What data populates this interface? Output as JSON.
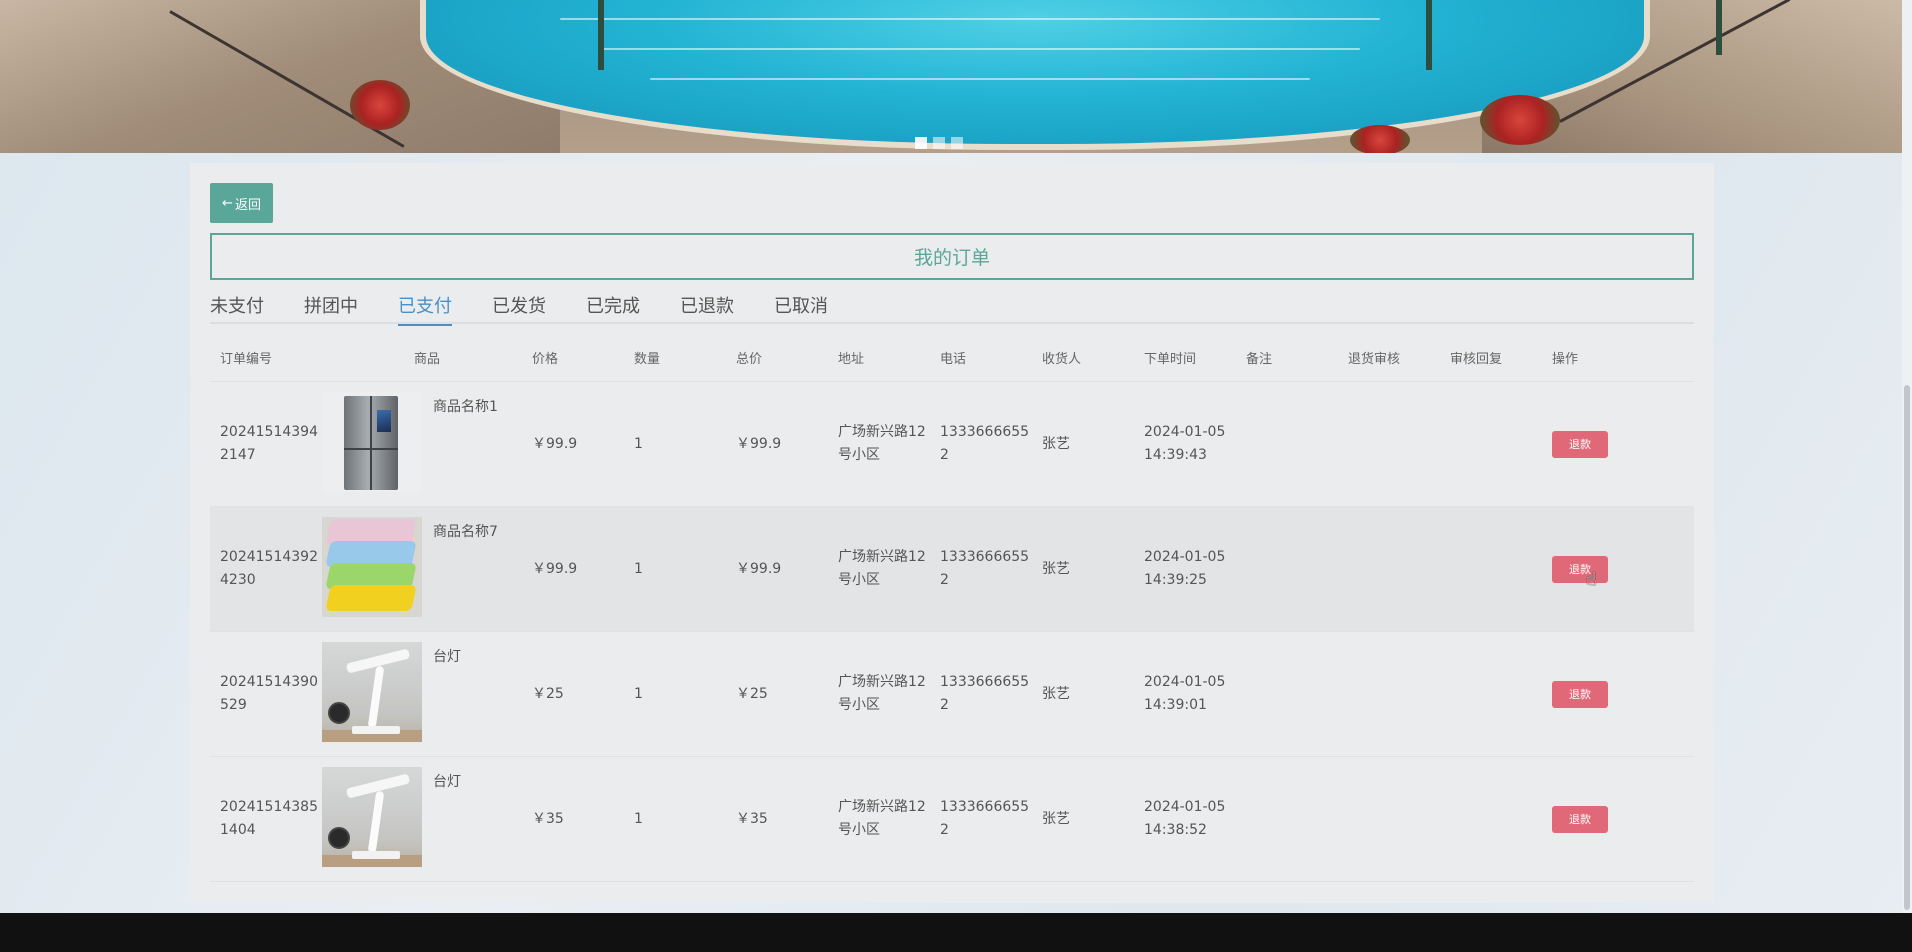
{
  "back_button": {
    "label": "返回",
    "icon": "arrow-left-icon"
  },
  "page_title": "我的订单",
  "tabs": [
    {
      "label": "未支付",
      "active": false
    },
    {
      "label": "拼团中",
      "active": false
    },
    {
      "label": "已支付",
      "active": true
    },
    {
      "label": "已发货",
      "active": false
    },
    {
      "label": "已完成",
      "active": false
    },
    {
      "label": "已退款",
      "active": false
    },
    {
      "label": "已取消",
      "active": false
    }
  ],
  "table": {
    "headers": {
      "order_no": "订单编号",
      "product": "商品",
      "price": "价格",
      "quantity": "数量",
      "total": "总价",
      "address": "地址",
      "phone": "电话",
      "receiver": "收货人",
      "order_time": "下单时间",
      "note": "备注",
      "return_audit": "退货审核",
      "audit_reply": "审核回复",
      "action": "操作"
    },
    "rows": [
      {
        "order_no": "202415143942147",
        "product_name": "商品名称1",
        "product_image": "fridge-image",
        "price": "￥99.9",
        "quantity": "1",
        "total": "￥99.9",
        "address": "广场新兴路12号小区",
        "phone": "13336666552",
        "receiver": "张艺",
        "order_time": "2024-01-05 14:39:43",
        "note": "",
        "return_audit": "",
        "audit_reply": "",
        "action": "退款"
      },
      {
        "order_no": "202415143924230",
        "product_name": "商品名称7",
        "product_image": "towels-image",
        "price": "￥99.9",
        "quantity": "1",
        "total": "￥99.9",
        "address": "广场新兴路12号小区",
        "phone": "13336666552",
        "receiver": "张艺",
        "order_time": "2024-01-05 14:39:25",
        "note": "",
        "return_audit": "",
        "audit_reply": "",
        "action": "退款"
      },
      {
        "order_no": "20241514390529",
        "product_name": "台灯",
        "product_image": "desk-lamp-image",
        "price": "￥25",
        "quantity": "1",
        "total": "￥25",
        "address": "广场新兴路12号小区",
        "phone": "13336666552",
        "receiver": "张艺",
        "order_time": "2024-01-05 14:39:01",
        "note": "",
        "return_audit": "",
        "audit_reply": "",
        "action": "退款"
      },
      {
        "order_no": "202415143851404",
        "product_name": "台灯",
        "product_image": "desk-lamp-image",
        "price": "￥35",
        "quantity": "1",
        "total": "￥35",
        "address": "广场新兴路12号小区",
        "phone": "13336666552",
        "receiver": "张艺",
        "order_time": "2024-01-05 14:38:52",
        "note": "",
        "return_audit": "",
        "audit_reply": "",
        "action": "退款"
      }
    ]
  },
  "colors": {
    "accent": "#5aa79a",
    "tab_active": "#4a90c8",
    "refund_button": "#e06878"
  }
}
